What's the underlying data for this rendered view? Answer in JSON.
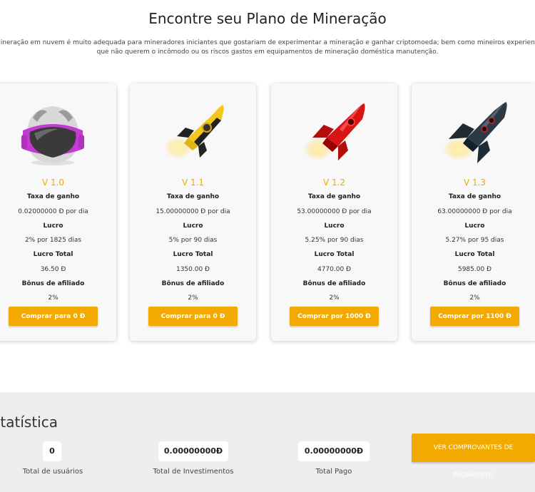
{
  "header": {
    "title": "Encontre seu Plano de Mineração",
    "desc_line1": "mineração em nuvem é muito adequada para mineradores iniciantes que gostariam de experimentar a mineração e ganhar criptomoeda; bem como mineiros experientes",
    "desc_line2": "que não querem o incômodo ou os riscos gastos em equipamentos de mineração doméstica manutenção."
  },
  "plans": [
    {
      "version": "V 1.0",
      "rate_label": "Taxa de ganho",
      "rate": "0.02000000 Đ por dia",
      "profit_label": "Lucro",
      "profit": "2% por 1825 dias",
      "total_label": "Lucro Total",
      "total": "36.50 Đ",
      "bonus_label": "Bônus de afiliado",
      "bonus": "2%",
      "button": "Comprar para 0 Đ",
      "icon": "astronaut-helmet-icon"
    },
    {
      "version": "V 1.1",
      "rate_label": "Taxa de ganho",
      "rate": "15.00000000 Đ por dia",
      "profit_label": "Lucro",
      "profit": "5% por 90 dias",
      "total_label": "Lucro Total",
      "total": "1350.00 Đ",
      "bonus_label": "Bônus de afiliado",
      "bonus": "2%",
      "button": "Comprar para 0 Đ",
      "icon": "yellow-rocket-icon"
    },
    {
      "version": "V 1.2",
      "rate_label": "Taxa de ganho",
      "rate": "53.00000000 Đ por dia",
      "profit_label": "Lucro",
      "profit": "5.25% por 90 dias",
      "total_label": "Lucro Total",
      "total": "4770.00 Đ",
      "bonus_label": "Bônus de afiliado",
      "bonus": "2%",
      "button": "Comprar por 1000 Đ",
      "icon": "red-rocket-icon"
    },
    {
      "version": "V 1.3",
      "rate_label": "Taxa de ganho",
      "rate": "63.00000000 Đ por dia",
      "profit_label": "Lucro",
      "profit": "5.27% por 95 dias",
      "total_label": "Lucro Total",
      "total": "5985.00 Đ",
      "bonus_label": "Bônus de afiliado",
      "bonus": "2%",
      "button": "Comprar por 1100 Đ",
      "icon": "dark-rocket-icon"
    }
  ],
  "stats": {
    "title": "statística",
    "users_value": "0",
    "users_label": "Total de usuários",
    "invest_value": "0.00000000Đ",
    "invest_label": "Total de Investimentos",
    "paid_value": "0.00000000Đ",
    "paid_label": "Total Pago",
    "proof_button_line1": "VER COMPROVANTES DE",
    "proof_button_line2": "PAGAMENTO"
  },
  "colors": {
    "accent": "#f2a900",
    "card_bg": "#f8f8f8",
    "stats_bg": "#eeeeee"
  }
}
